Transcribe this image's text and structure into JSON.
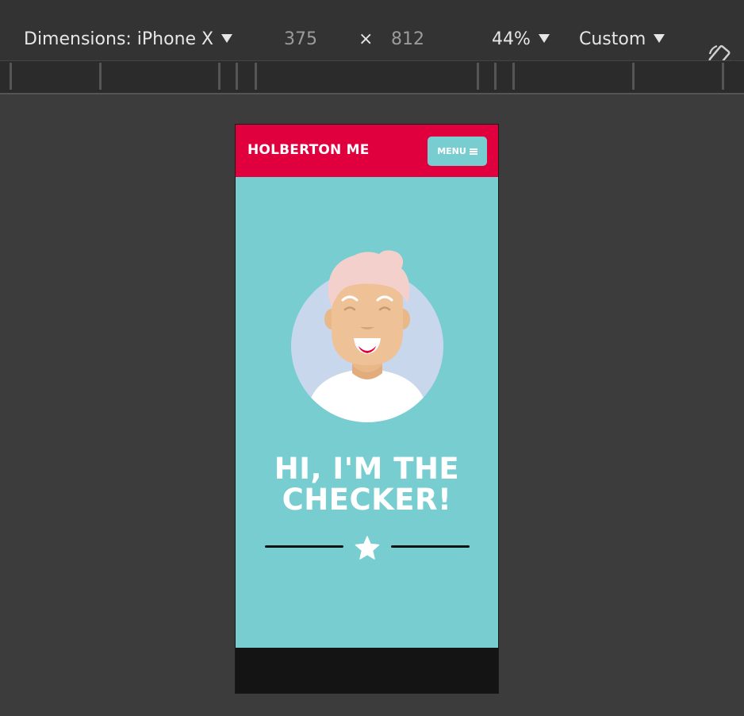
{
  "toolbar": {
    "dimensions_label": "Dimensions: iPhone X",
    "width_value": "375",
    "height_value": "812",
    "times_symbol": "×",
    "zoom_label": "44%",
    "throttle_label": "Custom"
  },
  "site": {
    "brand": "HOLBERTON ME",
    "menu_label": "MENU",
    "headline_line1": "HI, I'M THE",
    "headline_line2": "CHECKER!"
  },
  "colors": {
    "header_red": "#e0003d",
    "teal": "#77cdd0",
    "footer": "#141414"
  },
  "icons": {
    "menu": "hamburger-icon",
    "rotate": "rotate-device-icon",
    "divider": "star-icon"
  }
}
